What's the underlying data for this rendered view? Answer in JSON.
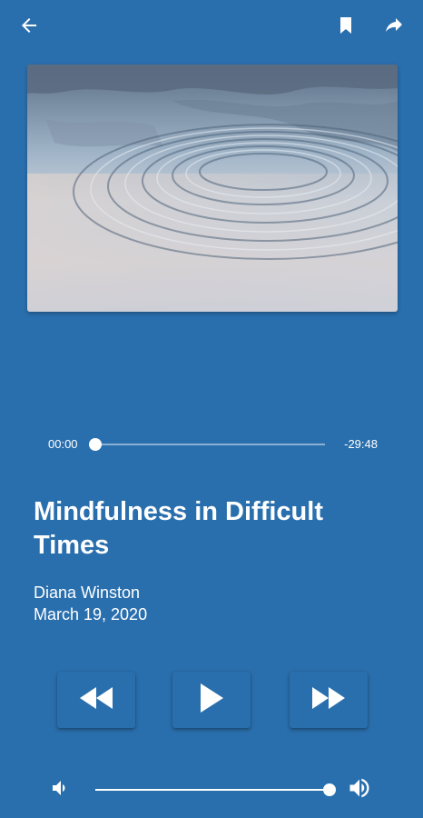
{
  "icons": {
    "back": "arrow-left-icon",
    "bookmark": "bookmark-icon",
    "share": "share-icon",
    "rewind": "rewind-icon",
    "play": "play-icon",
    "forward": "fast-forward-icon",
    "volume_low": "volume-low-icon",
    "volume_high": "volume-high-icon"
  },
  "player": {
    "elapsed": "00:00",
    "remaining": "-29:48",
    "progress": 0.0,
    "volume": 1.0
  },
  "track": {
    "title": "Mindfulness in Difficult Times",
    "author": "Diana Winston",
    "date": "March 19, 2020"
  },
  "colors": {
    "background": "#2a6fad",
    "foreground": "#ffffff",
    "track_inactive": "rgba(255,255,255,0.45)"
  }
}
